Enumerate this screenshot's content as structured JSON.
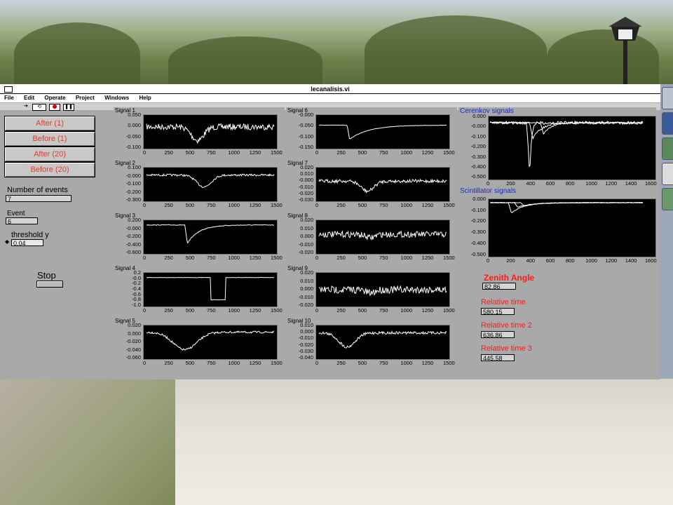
{
  "window": {
    "title": "lecanalisis.vi",
    "menus": [
      "File",
      "Edit",
      "Operate",
      "Project",
      "Windows",
      "Help"
    ]
  },
  "controls": {
    "buttons": [
      "After (1)",
      "Before (1)",
      "After (20)",
      "Before (20)"
    ],
    "number_of_events_label": "Number of events",
    "number_of_events_value": "7",
    "event_label": "Event",
    "event_value": "6",
    "threshold_label": "threshold y",
    "threshold_value": "0.04",
    "stop_label": "Stop"
  },
  "signals": [
    {
      "title": "Signal 1",
      "yticks": [
        "0.050",
        "0.000",
        "-0.050",
        "-0.100"
      ]
    },
    {
      "title": "Signal 2",
      "yticks": [
        "0.100",
        "-0.000",
        "-0.100",
        "-0.200",
        "-0.300"
      ]
    },
    {
      "title": "Signal 3",
      "yticks": [
        "0.200",
        "-0.000",
        "-0.200",
        "-0.400",
        "-0.600"
      ]
    },
    {
      "title": "Signal 4",
      "yticks": [
        "0.2",
        "-0.0",
        "-0.2",
        "-0.4",
        "-0.6",
        "-0.8",
        "-1.0"
      ]
    },
    {
      "title": "Signal 5",
      "yticks": [
        "0.020",
        "0.000",
        "-0.020",
        "-0.040",
        "-0.060"
      ]
    },
    {
      "title": "Signal 6",
      "yticks": [
        "-0.000",
        "-0.050",
        "-0.100",
        "-0.150"
      ]
    },
    {
      "title": "Signal 7",
      "yticks": [
        "0.020",
        "0.010",
        "-0.000",
        "-0.010",
        "-0.020",
        "-0.030"
      ]
    },
    {
      "title": "Signal 8",
      "yticks": [
        "0.020",
        "0.010",
        "0.000",
        "-0.010",
        "-0.020"
      ]
    },
    {
      "title": "Signal 9",
      "yticks": [
        "0.020",
        "0.010",
        "0.000",
        "-0.010",
        "-0.020"
      ]
    },
    {
      "title": "Signal 10",
      "yticks": [
        "0.010",
        "0.000",
        "-0.010",
        "-0.020",
        "-0.030",
        "-0.040"
      ]
    }
  ],
  "signal_xticks": [
    "0",
    "250",
    "500",
    "750",
    "1000",
    "1250",
    "1500"
  ],
  "cerenkov": {
    "title": "Cerenkov signals",
    "yticks": [
      "0.000",
      "-0.000",
      "-0.100",
      "-0.200",
      "-0.300",
      "-0.400",
      "-0.500"
    ],
    "xticks": [
      "0",
      "200",
      "400",
      "600",
      "800",
      "1000",
      "1200",
      "1400",
      "1600"
    ]
  },
  "scintillator": {
    "title": "Scintillator signals",
    "yticks": [
      "0.000",
      "-0.100",
      "-0.200",
      "-0.300",
      "-0.400",
      "-0.500"
    ],
    "xticks": [
      "0",
      "200",
      "400",
      "600",
      "800",
      "1000",
      "1200",
      "1400",
      "1600"
    ]
  },
  "results": {
    "zenith_label": "Zenith Angle",
    "zenith_value": "82.86",
    "rt1_label": "Relative time",
    "rt1_value": "580.15",
    "rt2_label": "Relative time 2",
    "rt2_value": "636.86",
    "rt3_label": "Relative time 3",
    "rt3_value": "445.58"
  },
  "colors": {
    "window_bg": "#a9a9a9",
    "plot_bg": "#000000",
    "trace": "#ffffff",
    "button_text": "#e23a2a",
    "result_label": "#ff1a1a",
    "panel_title_blue": "#1a2acc"
  }
}
